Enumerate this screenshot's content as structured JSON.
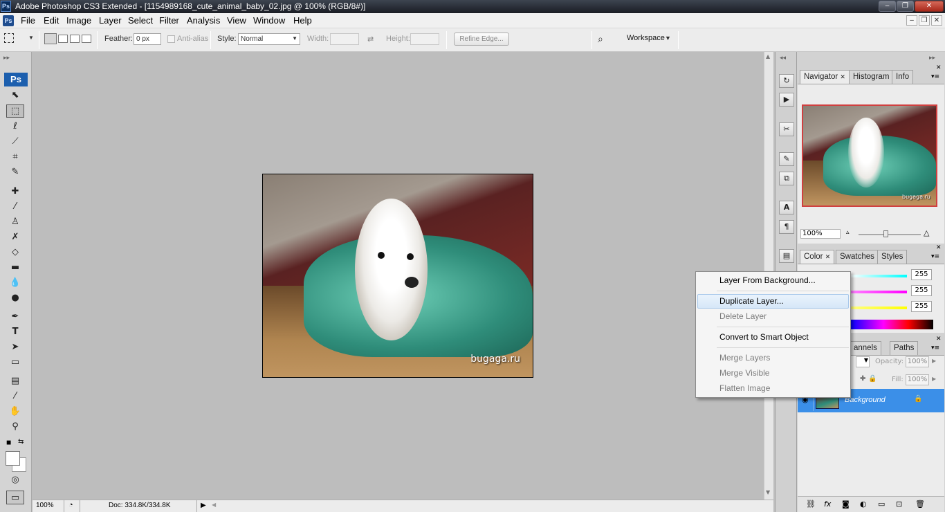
{
  "window": {
    "title": "Adobe Photoshop CS3 Extended - [1154989168_cute_animal_baby_02.jpg @ 100% (RGB/8#)]",
    "app_icon": "Ps"
  },
  "menubar": {
    "items": [
      "File",
      "Edit",
      "Image",
      "Layer",
      "Select",
      "Filter",
      "Analysis",
      "View",
      "Window",
      "Help"
    ]
  },
  "options": {
    "feather_label": "Feather:",
    "feather_value": "0 px",
    "antialias_label": "Anti-alias",
    "style_label": "Style:",
    "style_value": "Normal",
    "width_label": "Width:",
    "height_label": "Height:",
    "refine_edge_label": "Refine Edge...",
    "workspace_label": "Workspace"
  },
  "toolbox": {
    "logo": "Ps"
  },
  "canvas": {
    "watermark": "bugaga.ru"
  },
  "status": {
    "zoom": "100%",
    "doc": "Doc: 334.8K/334.8K"
  },
  "navigator": {
    "tabs": [
      "Navigator",
      "Histogram",
      "Info"
    ],
    "zoom": "100%",
    "watermark": "bugaga.ru"
  },
  "color": {
    "tabs": [
      "Color",
      "Swatches",
      "Styles"
    ],
    "values": [
      "255",
      "255",
      "255"
    ]
  },
  "layers": {
    "tabs": [
      "Channels",
      "Paths"
    ],
    "visible_tab_text": "annels",
    "opacity_label": "Opacity:",
    "opacity_value": "100%",
    "fill_label": "Fill:",
    "fill_value": "100%",
    "layer_name": "Background"
  },
  "context_menu": {
    "items": [
      {
        "label": "Layer From Background...",
        "disabled": false
      },
      {
        "label": "Duplicate Layer...",
        "disabled": false,
        "highlighted": true
      },
      {
        "label": "Delete Layer",
        "disabled": true
      },
      {
        "label": "Convert to Smart Object",
        "disabled": false
      },
      {
        "label": "Merge Layers",
        "disabled": true
      },
      {
        "label": "Merge Visible",
        "disabled": true
      },
      {
        "label": "Flatten Image",
        "disabled": true
      }
    ]
  },
  "colors": {
    "title_bar": "#2a2f38",
    "selection_blue": "#3b8fe8",
    "menu_highlight": "#dbe9f8"
  }
}
